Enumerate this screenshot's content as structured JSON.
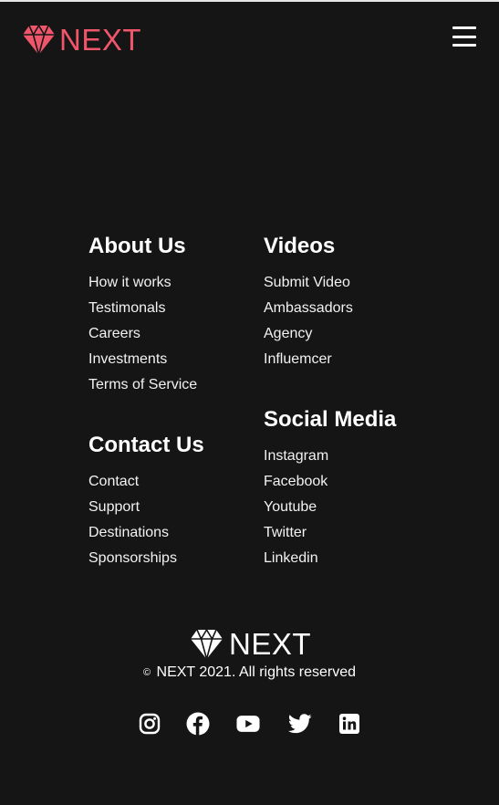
{
  "brand": {
    "name": "NEXT",
    "accent_color": "#f0566b"
  },
  "header": {
    "menu_icon": "hamburger-menu-icon"
  },
  "footer": {
    "columns": [
      {
        "heading": "About Us",
        "links": [
          "How it works",
          "Testimonals",
          "Careers",
          "Investments",
          "Terms of Service"
        ]
      },
      {
        "heading": "Contact Us",
        "links": [
          "Contact",
          "Support",
          "Destinations",
          "Sponsorships"
        ]
      },
      {
        "heading": "Videos",
        "links": [
          "Submit Video",
          "Ambassadors",
          "Agency",
          "Influemcer"
        ]
      },
      {
        "heading": "Social Media",
        "links": [
          "Instagram",
          "Facebook",
          "Youtube",
          "Twitter",
          "Linkedin"
        ]
      }
    ],
    "brand_name": "NEXT",
    "copyright_symbol": "©",
    "copyright": "NEXT 2021. All rights reserved",
    "social_icons": [
      "instagram-icon",
      "facebook-icon",
      "youtube-icon",
      "twitter-icon",
      "linkedin-icon"
    ]
  },
  "colors": {
    "background": "#151515",
    "text": "#ffffff"
  }
}
